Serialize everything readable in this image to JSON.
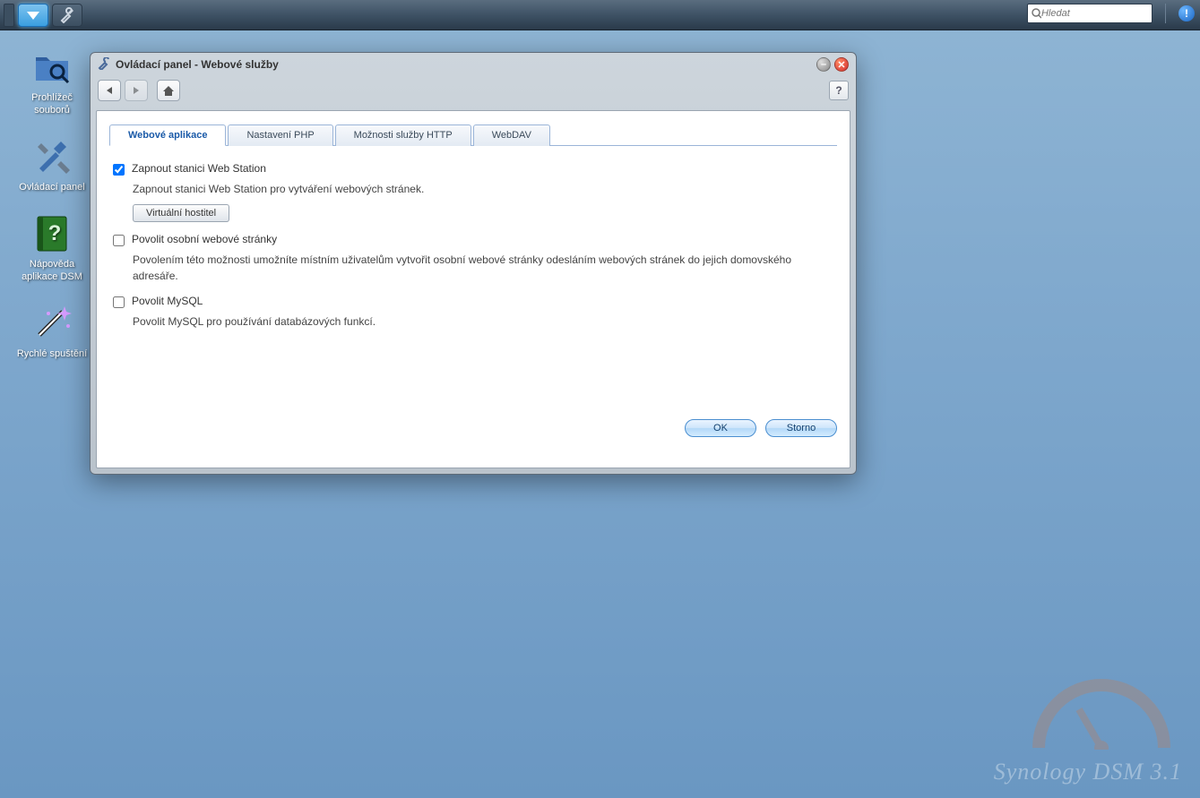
{
  "taskbar": {
    "search_placeholder": "Hledat"
  },
  "desktop": {
    "icons": [
      {
        "label": "Prohlížeč souborů"
      },
      {
        "label": "Ovládací panel"
      },
      {
        "label": "Nápověda aplikace DSM"
      },
      {
        "label": "Rychlé spuštění"
      }
    ]
  },
  "window": {
    "title": "Ovládací panel - Webové služby",
    "help_label": "?",
    "tabs": [
      {
        "label": "Webové aplikace"
      },
      {
        "label": "Nastavení PHP"
      },
      {
        "label": "Možnosti služby HTTP"
      },
      {
        "label": "WebDAV"
      }
    ],
    "checks": {
      "webstation_label": "Zapnout stanici Web Station",
      "webstation_desc": "Zapnout stanici Web Station pro vytváření webových stránek.",
      "vhost_btn": "Virtuální hostitel",
      "personal_label": "Povolit osobní webové stránky",
      "personal_desc": "Povolením této možnosti umožníte místním uživatelům vytvořit osobní webové stránky odesláním webových stránek do jejich domovského adresáře.",
      "mysql_label": "Povolit MySQL",
      "mysql_desc": "Povolit MySQL pro používání databázových funkcí."
    },
    "buttons": {
      "ok": "OK",
      "cancel": "Storno"
    }
  },
  "watermark": "Synology DSM 3.1"
}
